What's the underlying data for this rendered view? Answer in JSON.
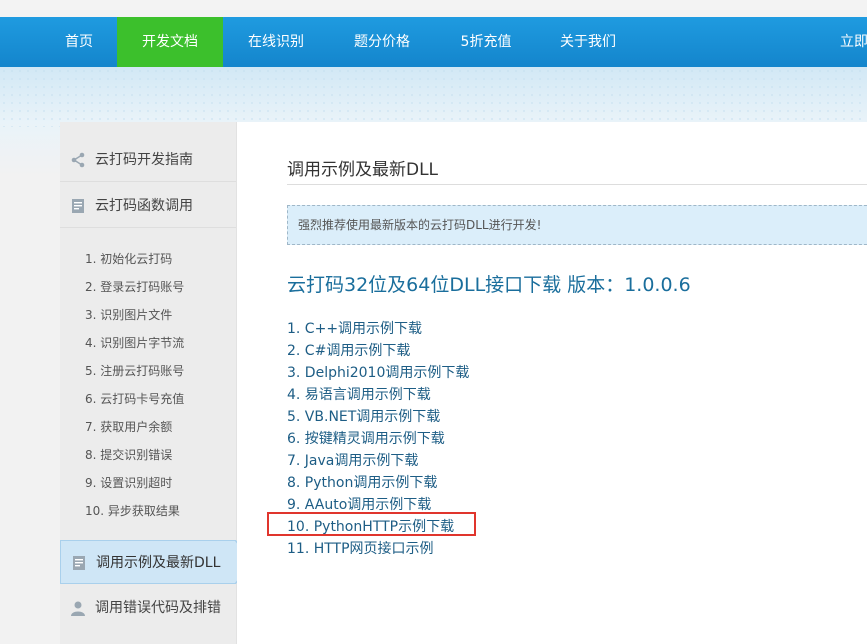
{
  "nav": {
    "items": [
      "首页",
      "开发文档",
      "在线识别",
      "题分价格",
      "5折充值",
      "关于我们"
    ],
    "right_label": "立即"
  },
  "sidebar": {
    "sections": [
      {
        "label": "云打码开发指南",
        "icon": "share-icon"
      },
      {
        "label": "云打码函数调用",
        "icon": "document-icon"
      }
    ],
    "subitems": [
      "1. 初始化云打码",
      "2. 登录云打码账号",
      "3. 识别图片文件",
      "4. 识别图片字节流",
      "5. 注册云打码账号",
      "6. 云打码卡号充值",
      "7. 获取用户余额",
      "8. 提交识别错误",
      "9. 设置识别超时",
      "10. 异步获取结果"
    ],
    "bottom_sections": [
      {
        "label": "调用示例及最新DLL",
        "icon": "document-icon",
        "active": true
      },
      {
        "label": "调用错误代码及排错",
        "icon": "user-icon"
      }
    ]
  },
  "main": {
    "title": "调用示例及最新DLL",
    "notice": "强烈推荐使用最新版本的云打码DLL进行开发!",
    "download_title": "云打码32位及64位DLL接口下载 版本：1.0.0.6",
    "links": [
      "1. C++调用示例下载",
      "2. C#调用示例下载",
      "3. Delphi2010调用示例下载",
      "4. 易语言调用示例下载",
      "5. VB.NET调用示例下载",
      "6. 按键精灵调用示例下载",
      "7. Java调用示例下载",
      "8. Python调用示例下载",
      "9. AAuto调用示例下载",
      "10. PythonHTTP示例下载",
      "11. HTTP网页接口示例"
    ]
  },
  "colors": {
    "nav_blue": "#1485cc",
    "nav_active_green": "#3cc02c",
    "link_blue": "#1d5d85",
    "highlight_red": "#e0352d"
  }
}
